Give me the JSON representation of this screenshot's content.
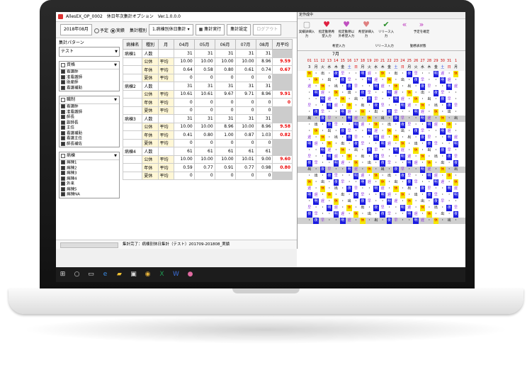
{
  "window": {
    "title": "AllesEX_OP_0002　休日年次集計オプション　Ver.1.0.0.0"
  },
  "toolbar": {
    "month": "2018年08月",
    "radio_plan": "予定",
    "radio_actual": "実績",
    "type_label": "集計種別",
    "type_value": "1.病棟別休日集計",
    "run_label": "集計実行",
    "settings_label": "集計設定",
    "logout_label": "ログアウト"
  },
  "left": {
    "pattern_label": "集計パターン",
    "pattern_value": "テスト",
    "groups": [
      {
        "header": "資格",
        "items": [
          "看護師",
          "准看護師",
          "助産師",
          "看護補助"
        ]
      },
      {
        "header": "職制",
        "items": [
          "看護師",
          "准看護師",
          "師長",
          "副師長",
          "主任",
          "看護補助",
          "看護主任",
          "師長補佐"
        ]
      },
      {
        "header": "病棟",
        "items": [
          "病棟1",
          "病棟2",
          "病棟3",
          "病棟4",
          "外来",
          "病棟5",
          "病棟NA"
        ]
      }
    ]
  },
  "grid": {
    "headers": [
      "病棟名",
      "種別",
      "月",
      "04月",
      "05月",
      "06月",
      "07月",
      "08月",
      "月平均"
    ],
    "rows": [
      [
        "病棟1",
        "人数",
        "",
        "31",
        "31",
        "31",
        "31",
        "31",
        ""
      ],
      [
        "",
        "公休",
        "平均",
        "10.00",
        "10.00",
        "10.00",
        "10.00",
        "8.96",
        "9.59"
      ],
      [
        "",
        "年休",
        "平均",
        "0.64",
        "0.58",
        "0.80",
        "0.61",
        "0.74",
        "0.67"
      ],
      [
        "",
        "夏休",
        "平均",
        "0",
        "0",
        "0",
        "0",
        "0",
        ""
      ],
      [
        "病棟2",
        "人数",
        "",
        "31",
        "31",
        "31",
        "31",
        "31",
        ""
      ],
      [
        "",
        "公休",
        "平均",
        "10.61",
        "10.61",
        "9.67",
        "9.71",
        "8.96",
        "9.91"
      ],
      [
        "",
        "年休",
        "平均",
        "0",
        "0",
        "0",
        "0",
        "0",
        "0"
      ],
      [
        "",
        "夏休",
        "平均",
        "0",
        "0",
        "0",
        "0",
        "0",
        ""
      ],
      [
        "病棟3",
        "人数",
        "",
        "31",
        "31",
        "31",
        "31",
        "31",
        ""
      ],
      [
        "",
        "公休",
        "平均",
        "10.00",
        "10.00",
        "8.96",
        "10.00",
        "8.96",
        "9.58"
      ],
      [
        "",
        "年休",
        "平均",
        "0.41",
        "0.80",
        "1.00",
        "0.87",
        "1.03",
        "0.82"
      ],
      [
        "",
        "夏休",
        "平均",
        "0",
        "0",
        "0",
        "0",
        "0",
        ""
      ],
      [
        "病棟4",
        "人数",
        "",
        "61",
        "61",
        "61",
        "61",
        "61",
        ""
      ],
      [
        "",
        "公休",
        "平均",
        "10.00",
        "10.00",
        "10.00",
        "10.01",
        "9.00",
        "9.60"
      ],
      [
        "",
        "年休",
        "平均",
        "0.59",
        "0.77",
        "0.91",
        "0.77",
        "0.98",
        "0.80"
      ],
      [
        "",
        "夏休",
        "平均",
        "0",
        "0",
        "0",
        "0",
        "0",
        ""
      ]
    ]
  },
  "status": {
    "text": "集計完了：病棟別休日集計（テスト）201709-201808_実績"
  },
  "schedule": {
    "title": "定作成中",
    "buttons": [
      "実績詳細入力",
      "指定勤務希望入力",
      "指定勤務以外希望入力",
      "希望詳細入力",
      "リリース入力",
      "予定を確定"
    ],
    "groups": [
      "希望入力",
      "リリース入力",
      "勤務表状態"
    ],
    "month": "7月",
    "days": [
      "01",
      "11",
      "12",
      "13",
      "14",
      "15",
      "16",
      "17",
      "18",
      "19",
      "20",
      "21",
      "22",
      "23",
      "24",
      "25",
      "26",
      "27",
      "28",
      "29",
      "30",
      "31",
      "1"
    ],
    "weekdays": [
      "3",
      "月",
      "火",
      "水",
      "木",
      "金",
      "土",
      "日",
      "月",
      "火",
      "水",
      "木",
      "金",
      "土",
      "日",
      "月",
      "火",
      "水",
      "木",
      "金",
      "土",
      "日",
      "月"
    ],
    "codes": [
      "休",
      "夜",
      "明",
      "・",
      "早",
      "遅",
      "出"
    ],
    "colors": {
      "night": "#1a1ae0",
      "holiday": "#f5e800",
      "sunday": "#e00000"
    }
  }
}
